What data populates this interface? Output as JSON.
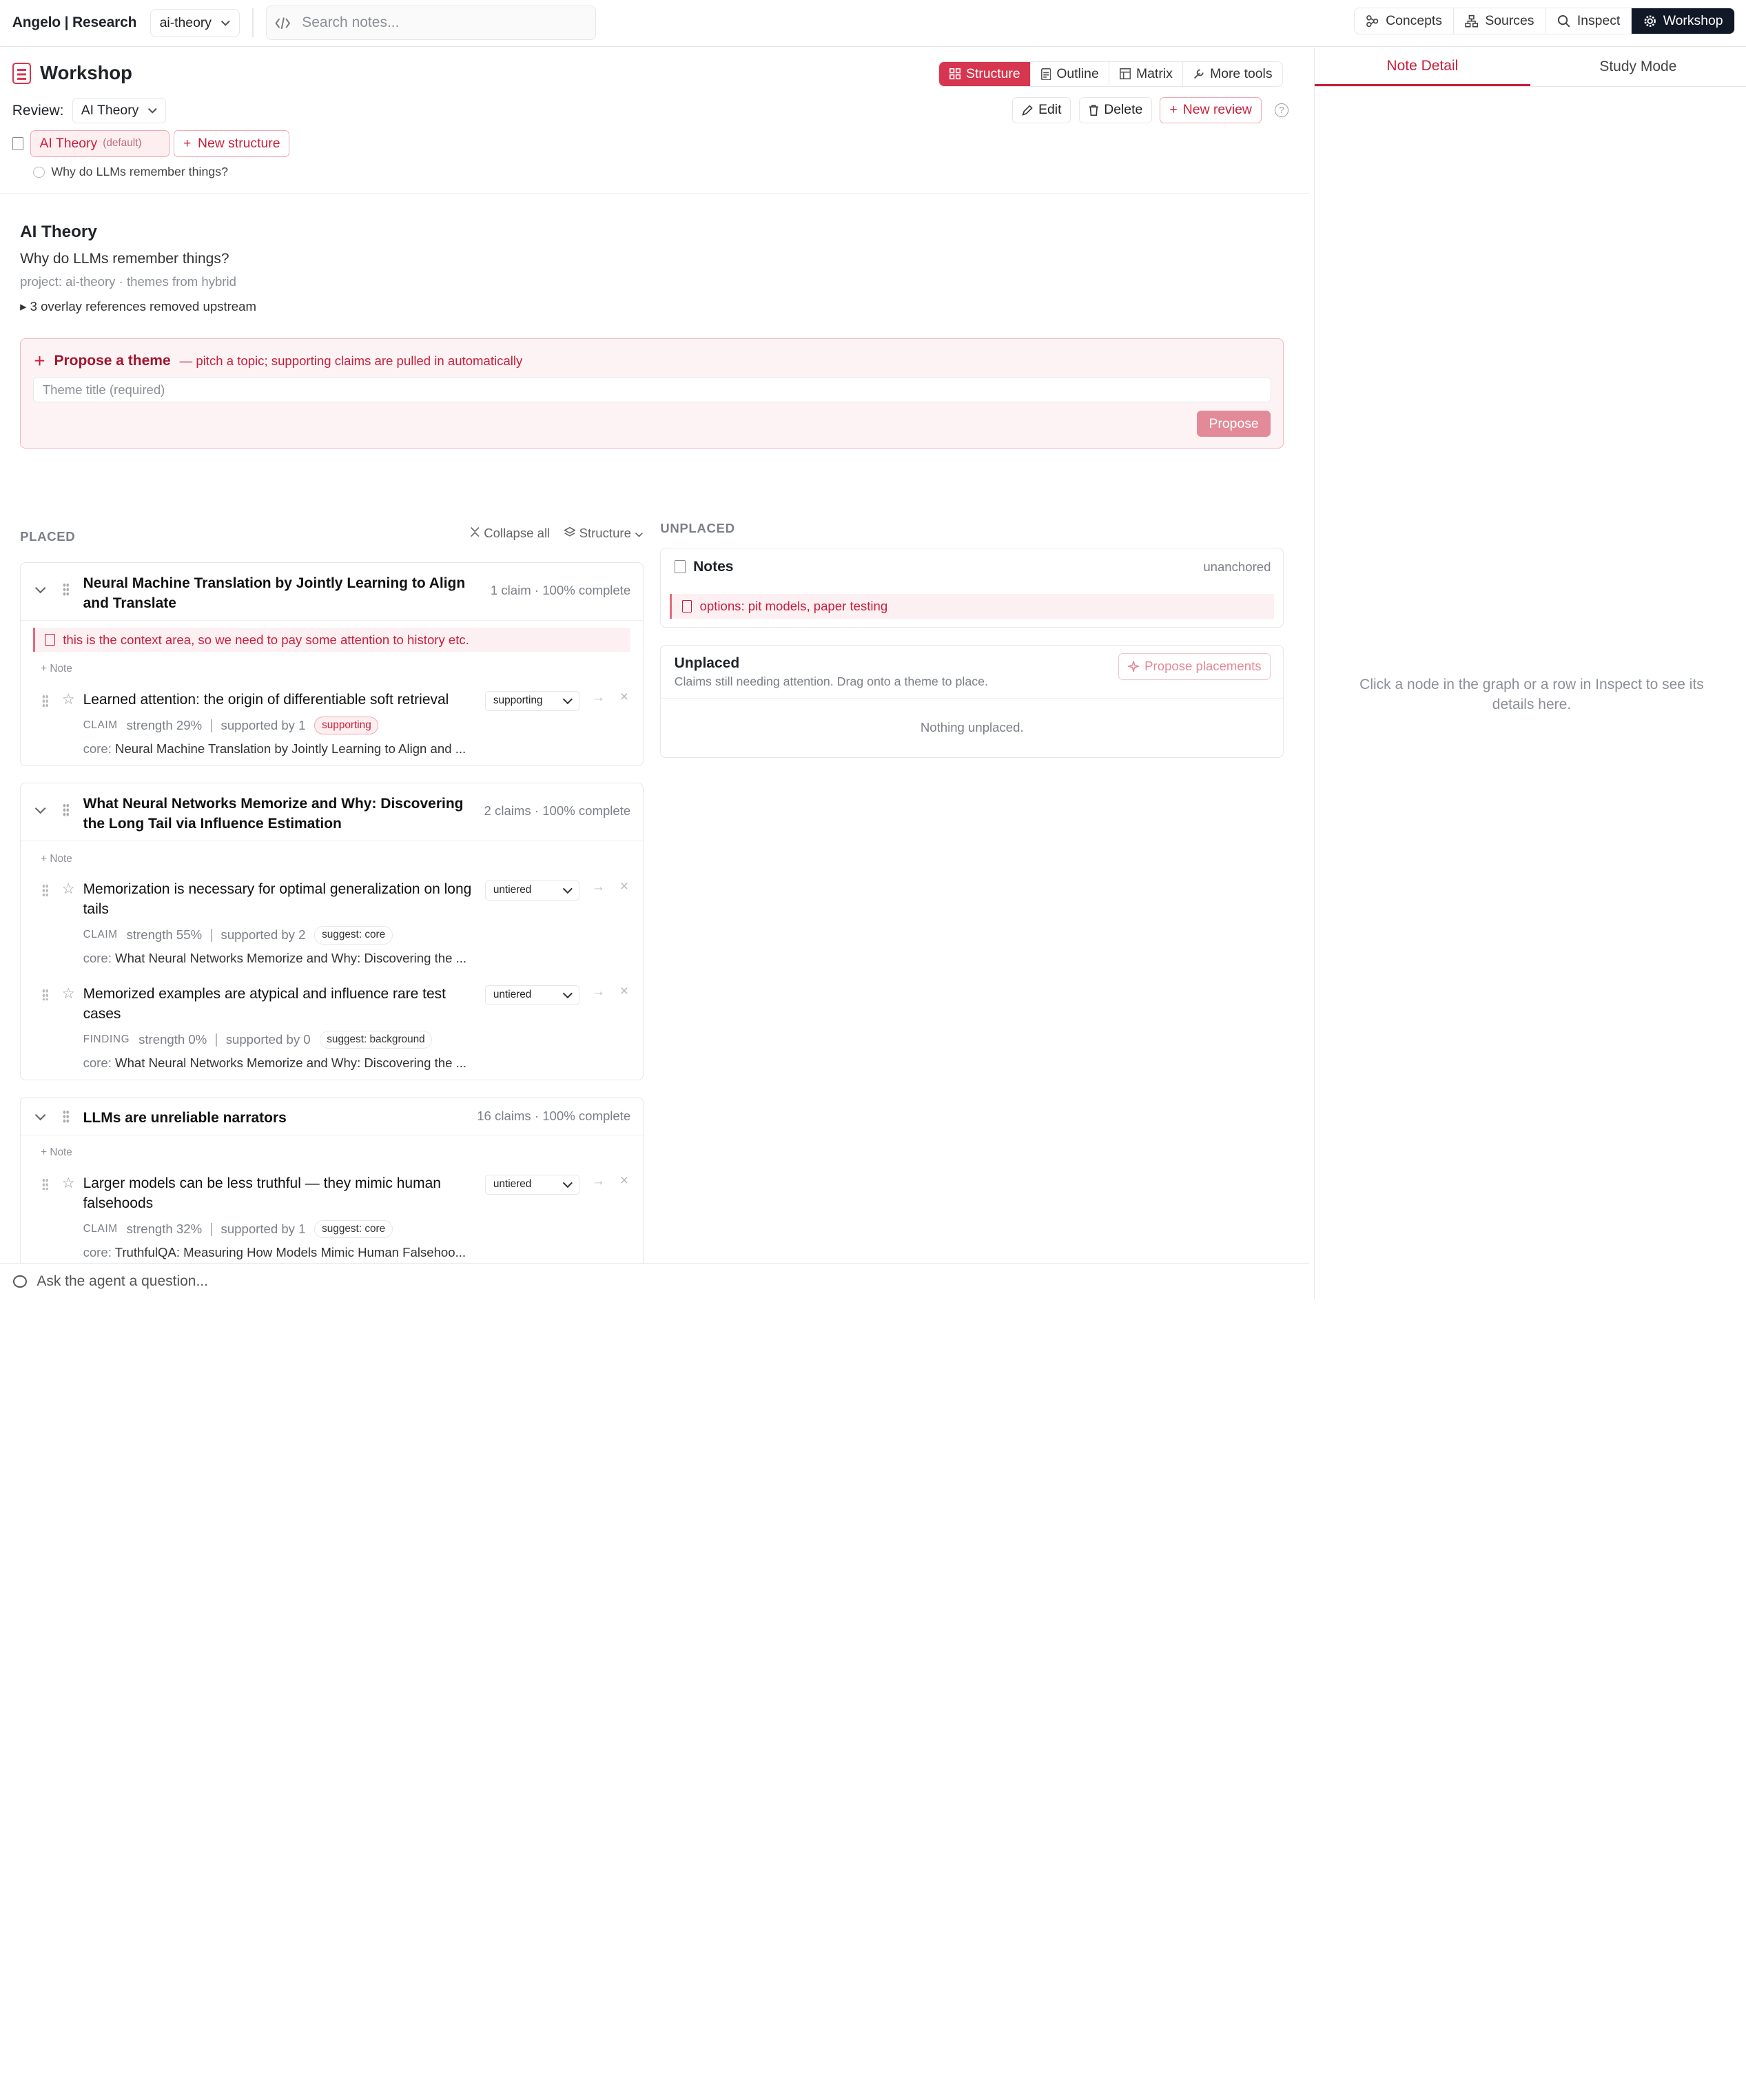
{
  "topbar": {
    "brand": "Angelo | Research",
    "project": "ai-theory",
    "search_placeholder": "Search notes...",
    "nav": [
      {
        "label": "Concepts",
        "icon": "concepts-icon"
      },
      {
        "label": "Sources",
        "icon": "sources-icon"
      },
      {
        "label": "Inspect",
        "icon": "search-icon"
      },
      {
        "label": "Workshop",
        "icon": "gear-icon",
        "active": true
      }
    ]
  },
  "header": {
    "title": "Workshop",
    "view_tabs": [
      {
        "label": "Structure",
        "active": true
      },
      {
        "label": "Outline"
      },
      {
        "label": "Matrix"
      },
      {
        "label": "More tools"
      }
    ],
    "review_label": "Review:",
    "review_value": "AI Theory",
    "actions": {
      "edit": "Edit",
      "delete": "Delete",
      "new_review": "New review"
    },
    "structure_chip": "AI Theory",
    "structure_default": "(default)",
    "new_structure": "New structure",
    "question": "Why do LLMs remember things?"
  },
  "content": {
    "title": "AI Theory",
    "question": "Why do LLMs remember things?",
    "meta": "project: ai-theory · themes from hybrid",
    "overlay": "3 overlay references removed upstream"
  },
  "propose": {
    "title": "Propose a theme",
    "subtitle": "— pitch a topic; supporting claims are pulled in automatically",
    "placeholder": "Theme title (required)",
    "button": "Propose"
  },
  "placed": {
    "label": "PLACED",
    "collapse_all": "Collapse all",
    "structure": "Structure",
    "add_note": "Note",
    "themes": [
      {
        "title": "Neural Machine Translation by Jointly Learning to Align and Translate",
        "meta": "1 claim · 100% complete",
        "context_note": "this is the context area, so we need to pay some attention to history etc.",
        "claims": [
          {
            "text": "Learned attention: the origin of differentiable soft retrieval",
            "tier": "supporting",
            "type": "CLAIM",
            "strength": "strength 29%",
            "supported": "supported by 1",
            "tag": "supporting",
            "core_label": "core:",
            "core": "Neural Machine Translation by Jointly Learning to Align and ..."
          }
        ]
      },
      {
        "title": "What Neural Networks Memorize and Why: Discovering the Long Tail via Influence Estimation",
        "meta": "2 claims · 100% complete",
        "claims": [
          {
            "text": "Memorization is necessary for optimal generalization on long tails",
            "tier": "untiered",
            "type": "CLAIM",
            "strength": "strength 55%",
            "supported": "supported by 2",
            "tag": "suggest: core",
            "core_label": "core:",
            "core": "What Neural Networks Memorize and Why: Discovering the ..."
          },
          {
            "text": "Memorized examples are atypical and influence rare test cases",
            "tier": "untiered",
            "type": "FINDING",
            "strength": "strength 0%",
            "supported": "supported by 0",
            "tag": "suggest: background",
            "core_label": "core:",
            "core": "What Neural Networks Memorize and Why: Discovering the ..."
          }
        ]
      },
      {
        "title": "LLMs are unreliable narrators",
        "meta": "16 claims · 100% complete",
        "claims": [
          {
            "text": "Larger models can be less truthful — they mimic human falsehoods",
            "tier": "untiered",
            "type": "CLAIM",
            "strength": "strength 32%",
            "supported": "supported by 1",
            "tag": "suggest: core",
            "core_label": "core:",
            "core": "TruthfulQA: Measuring How Models Mimic Human Falsehoo..."
          }
        ]
      }
    ]
  },
  "unplaced": {
    "label": "UNPLACED",
    "notes_title": "Notes",
    "notes_status": "unanchored",
    "note_item": "options: pit models, paper testing",
    "title": "Unplaced",
    "subtitle": "Claims still needing attention. Drag onto a theme to place.",
    "propose_button": "Propose placements",
    "empty": "Nothing unplaced."
  },
  "right": {
    "tabs": [
      {
        "label": "Note Detail",
        "active": true
      },
      {
        "label": "Study Mode"
      }
    ],
    "empty": "Click a node in the graph or a row in Inspect to see its details here."
  },
  "ask": {
    "placeholder": "Ask the agent a question..."
  },
  "colors": {
    "accent": "#d6364f",
    "accent_dark": "#c81e3a",
    "nav_active": "#111827"
  }
}
